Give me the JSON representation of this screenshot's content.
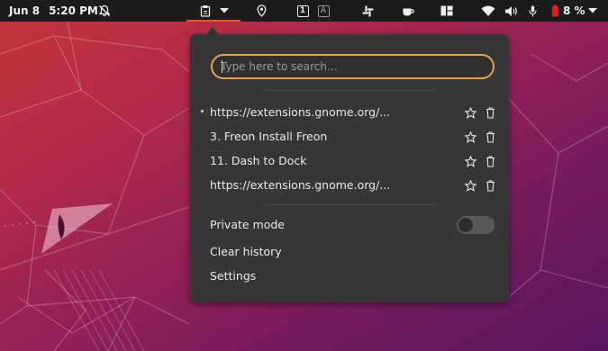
{
  "topbar": {
    "date": "Jun 8",
    "time": "5:20 PM",
    "battery_percent": "8 %",
    "icons": {
      "notifications": "bell-off-icon",
      "clipboard": "clipboard-icon",
      "clipboard_menu": "dropdown-arrow-icon",
      "location": "location-pin-icon",
      "workspace": "workspace-indicator-icon",
      "keyboard_layout": "keyboard-layout-icon",
      "slack": "slack-icon",
      "caffeine": "coffee-cup-icon",
      "layout": "window-layout-icon",
      "wifi": "wifi-icon",
      "volume": "volume-icon",
      "microphone": "microphone-icon",
      "battery": "battery-low-icon",
      "system_menu": "dropdown-arrow-icon"
    },
    "workspace_number": "1",
    "keyboard_letter": "A",
    "battery_color": "#e01b24"
  },
  "clipboard_popup": {
    "search_placeholder": "Type here to search...",
    "history": [
      {
        "text": "https://extensions.gnome.org/...",
        "active": true
      },
      {
        "text": "3. Freon Install Freon",
        "active": false
      },
      {
        "text": "11. Dash to Dock",
        "active": false
      },
      {
        "text": "https://extensions.gnome.org/...",
        "active": false
      }
    ],
    "row_icons": {
      "favorite": "star-outline-icon",
      "delete": "trash-icon"
    },
    "private_mode": {
      "label": "Private mode",
      "enabled": false
    },
    "clear_history_label": "Clear history",
    "settings_label": "Settings"
  },
  "colors": {
    "accent_orange": "#e95420",
    "search_focus": "#e4a155",
    "popup_bg": "#363636",
    "topbar_bg": "#1b1b1b"
  }
}
